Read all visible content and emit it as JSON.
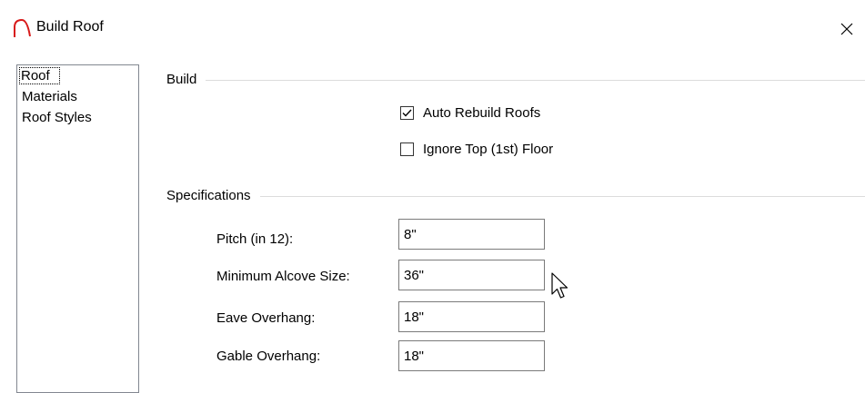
{
  "window": {
    "title": "Build Roof"
  },
  "nav": {
    "items": [
      "Roof",
      "Materials",
      "Roof Styles"
    ],
    "selected": 0
  },
  "build": {
    "label": "Build",
    "auto_rebuild": {
      "label": "Auto Rebuild Roofs",
      "checked": true
    },
    "ignore_top": {
      "label": "Ignore Top (1st) Floor",
      "checked": false
    }
  },
  "specs": {
    "label": "Specifications",
    "pitch": {
      "label": "Pitch (in 12):",
      "value": "8\""
    },
    "alcove": {
      "label": "Minimum Alcove Size:",
      "value": "36\""
    },
    "eave": {
      "label": "Eave Overhang:",
      "value": "18\""
    },
    "gable": {
      "label": "Gable Overhang:",
      "value": "18\""
    }
  }
}
